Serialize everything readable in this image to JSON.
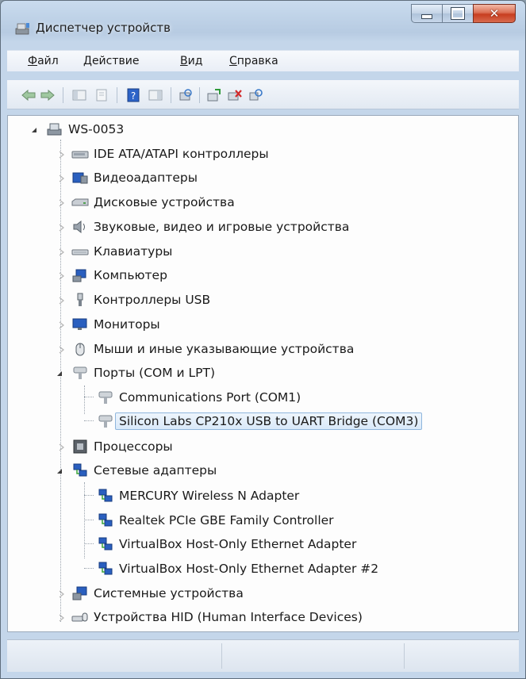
{
  "window": {
    "title": "Диспетчер устройств",
    "close_glyph": "✕"
  },
  "menu": [
    {
      "label": "Файл",
      "accel": "Ф",
      "rest": "айл"
    },
    {
      "label": "Действие",
      "accel": "Д",
      "rest": "ействие"
    },
    {
      "label": "Вид",
      "accel": "В",
      "rest": "ид"
    },
    {
      "label": "Справка",
      "accel": "С",
      "rest": "правка"
    }
  ],
  "tree": {
    "root": "WS-0053",
    "items": [
      {
        "label": "IDE ATA/ATAPI контроллеры",
        "icon": "ide-controller-icon",
        "expanded": false
      },
      {
        "label": "Видеоадаптеры",
        "icon": "display-adapter-icon",
        "expanded": false
      },
      {
        "label": "Дисковые устройства",
        "icon": "disk-drive-icon",
        "expanded": false
      },
      {
        "label": "Звуковые, видео и игровые устройства",
        "icon": "speaker-icon",
        "expanded": false
      },
      {
        "label": "Клавиатуры",
        "icon": "keyboard-icon",
        "expanded": false
      },
      {
        "label": "Компьютер",
        "icon": "computer-icon",
        "expanded": false
      },
      {
        "label": "Контроллеры USB",
        "icon": "usb-icon",
        "expanded": false
      },
      {
        "label": "Мониторы",
        "icon": "monitor-icon",
        "expanded": false
      },
      {
        "label": "Мыши и иные указывающие устройства",
        "icon": "mouse-icon",
        "expanded": false
      },
      {
        "label": "Порты (COM и LPT)",
        "icon": "port-icon",
        "expanded": true,
        "children": [
          {
            "label": "Communications Port (COM1)",
            "icon": "port-icon"
          },
          {
            "label": "Silicon Labs CP210x USB to UART Bridge (COM3)",
            "icon": "port-icon",
            "selected": true
          }
        ]
      },
      {
        "label": "Процессоры",
        "icon": "processor-icon",
        "expanded": false
      },
      {
        "label": "Сетевые адаптеры",
        "icon": "network-adapter-icon",
        "expanded": true,
        "children": [
          {
            "label": "MERCURY Wireless N Adapter",
            "icon": "network-adapter-icon"
          },
          {
            "label": "Realtek PCIe GBE Family Controller",
            "icon": "network-adapter-icon"
          },
          {
            "label": "VirtualBox Host-Only Ethernet Adapter",
            "icon": "network-adapter-icon"
          },
          {
            "label": "VirtualBox Host-Only Ethernet Adapter #2",
            "icon": "network-adapter-icon"
          }
        ]
      },
      {
        "label": "Системные устройства",
        "icon": "system-device-icon",
        "expanded": false
      },
      {
        "label": "Устройства HID (Human Interface Devices)",
        "icon": "hid-icon",
        "expanded": false
      }
    ]
  },
  "colors": {
    "selection_border": "#8fb6dd",
    "window_frame": "#b7cbe2"
  }
}
